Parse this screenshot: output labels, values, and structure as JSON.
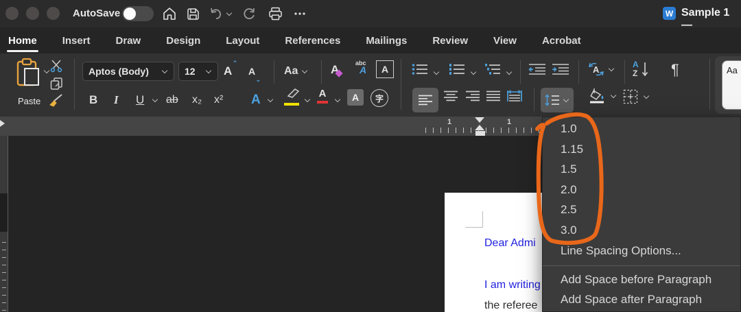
{
  "colors": {
    "accent_blue": "#4da0dd",
    "annotation_orange": "#e8671a",
    "doc_text_blue": "#1f1fe0",
    "highlight_yellow": "#f0e000",
    "font_color_red": "#e03434",
    "paste_clipboard_orange": "#e8a33d"
  },
  "window": {
    "autosave_label": "AutoSave",
    "title": "Sample 1 —",
    "word_logo_glyph": "W"
  },
  "tabs": {
    "items": [
      {
        "label": "Home"
      },
      {
        "label": "Insert"
      },
      {
        "label": "Draw"
      },
      {
        "label": "Design"
      },
      {
        "label": "Layout"
      },
      {
        "label": "References"
      },
      {
        "label": "Mailings"
      },
      {
        "label": "Review"
      },
      {
        "label": "View"
      },
      {
        "label": "Acrobat"
      }
    ]
  },
  "ribbon": {
    "paste_label": "Paste",
    "font_name": "Aptos (Body)",
    "font_size": "12",
    "glyphs": {
      "grow_font": "A",
      "shrink_font": "A",
      "change_case": "Aa",
      "clear_format": "A",
      "phonetic_top": "abc",
      "phonetic_a": "A",
      "char_border": "A",
      "bold": "B",
      "italic": "I",
      "underline": "U",
      "strikethrough": "ab",
      "subscript": "x₂",
      "superscript": "x²",
      "text_effects": "A",
      "font_color": "A",
      "char_shading": "A",
      "enclose": "字",
      "text_direction": "A",
      "sort_a": "A",
      "sort_z": "Z",
      "pilcrow": "¶",
      "styles_preview": "Aa"
    }
  },
  "ruler": {
    "numbers": [
      "1",
      "1"
    ]
  },
  "document": {
    "line1": "Dear Admi",
    "line2": "I am writing",
    "line3": "the referee"
  },
  "menu": {
    "spacing_options": [
      "1.0",
      "1.15",
      "1.5",
      "2.0",
      "2.5",
      "3.0"
    ],
    "line_spacing_options": "Line Spacing Options...",
    "add_space_before": "Add Space before Paragraph",
    "add_space_after": "Add Space after Paragraph"
  }
}
